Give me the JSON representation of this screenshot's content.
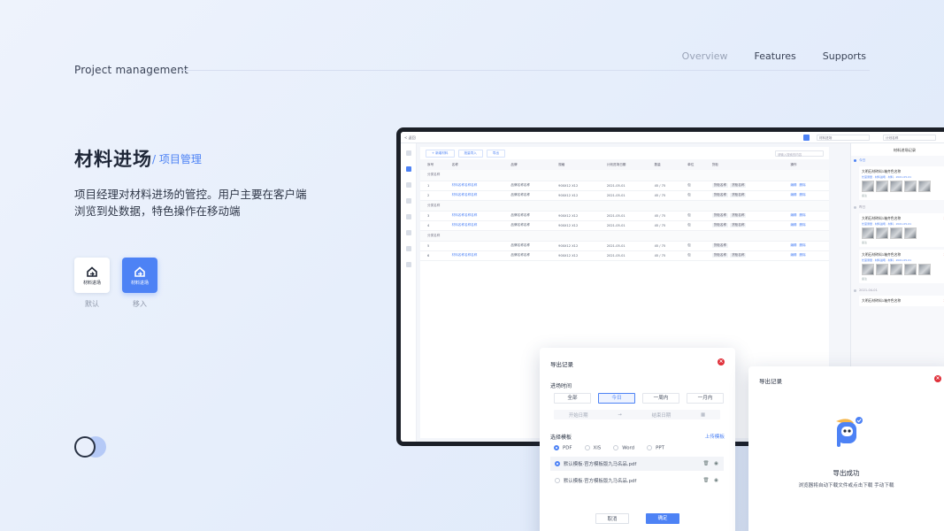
{
  "header": {
    "title": "Project management",
    "nav": [
      {
        "label": "Overview"
      },
      {
        "label": "Features"
      },
      {
        "label": "Supports"
      }
    ]
  },
  "hero": {
    "title": "材料进场",
    "subtitle": "/ 项目管理",
    "description": "项目经理对材料进场的管控。用户主要在客户端浏览到处数据，特色操作在移动端"
  },
  "icon_cards": [
    {
      "inner_label": "材料进场",
      "caption": "默认"
    },
    {
      "inner_label": "材料进场",
      "caption": "移入"
    }
  ],
  "colors": {
    "accent": "#4d82f5",
    "danger": "#e0303a",
    "success": "#3bb36a"
  },
  "app": {
    "back": "< 返回",
    "selects": [
      "材料进场",
      "计划名称"
    ],
    "toolbar": [
      "+ 新增材料",
      "批量导入",
      "导出"
    ],
    "search_placeholder": "请输入搜索的内容",
    "table_headers": [
      "序号",
      "名称",
      "品牌",
      "规格",
      "计划进场日期",
      "数量",
      "单位",
      "货柜",
      "操作"
    ],
    "groups": [
      {
        "name": "分类名称",
        "rows": [
          {
            "no": "1",
            "name": "材料名称名称名称",
            "brand": "品牌名称名称",
            "spec": "900X12 X12",
            "date": "2021-05-01",
            "qty": "45 / 75",
            "unit": "包",
            "tags": [
              "货柜名称",
              "货柜名称"
            ],
            "actions": [
              "编辑",
              "删除"
            ]
          },
          {
            "no": "2",
            "name": "材料名称名称名称",
            "brand": "品牌名称名称",
            "spec": "900X12 X12",
            "date": "2021-05-01",
            "qty": "45 / 75",
            "unit": "包",
            "tags": [
              "货柜名称",
              "货柜名称"
            ],
            "actions": [
              "编辑",
              "删除"
            ]
          }
        ]
      },
      {
        "name": "分类名称",
        "rows": [
          {
            "no": "3",
            "name": "材料名称名称名称",
            "brand": "品牌名称名称",
            "spec": "900X12 X12",
            "date": "2021-05-01",
            "qty": "45 / 75",
            "unit": "包",
            "tags": [
              "货柜名称",
              "货柜名称"
            ],
            "actions": [
              "编辑",
              "删除"
            ]
          },
          {
            "no": "4",
            "name": "材料名称名称名称",
            "brand": "品牌名称名称",
            "spec": "900X12 X12",
            "date": "2021-05-01",
            "qty": "45 / 75",
            "unit": "包",
            "tags": [
              "货柜名称",
              "货柜名称"
            ],
            "actions": [
              "编辑",
              "删除"
            ]
          }
        ]
      },
      {
        "name": "分类名称",
        "rows": [
          {
            "no": "5",
            "name": "",
            "brand": "品牌名称名称",
            "spec": "900X12 X12",
            "date": "2021-05-01",
            "qty": "45 / 75",
            "unit": "包",
            "tags": [
              "货柜名称"
            ],
            "actions": [
              "编辑",
              "删除"
            ]
          },
          {
            "no": "6",
            "name": "材料名称名称名称",
            "brand": "品牌名称名称",
            "spec": "900X12 X12",
            "date": "2021-05-01",
            "qty": "45 / 75",
            "unit": "包",
            "tags": [
              "货柜名称",
              "货柜名称"
            ],
            "actions": [
              "编辑",
              "删除"
            ]
          }
        ]
      }
    ],
    "records_panel": {
      "title": "材料进场记录",
      "days": [
        {
          "label": "今日",
          "cards": [
            {
              "title": "大明石材砖料1箱齐色名称",
              "status": "合格",
              "ok": true,
              "meta": "长度测量 · 材料进场 · 材料 · 2021-05-01",
              "note": "备注",
              "imgs": 5
            }
          ]
        },
        {
          "label": "昨日",
          "cards": [
            {
              "title": "大明石材砖料1箱齐色名称",
              "status": "不合格",
              "ok": false,
              "meta": "长度测量 · 材料进场 · 材料 · 2021-05-01",
              "note": "备注",
              "imgs": 4
            },
            {
              "title": "大明石材砖料1箱齐色名称",
              "status": "不合格",
              "ok": false,
              "meta": "长度测量 · 材料进场 · 材料 · 2021-05-01",
              "note": "备注",
              "imgs": 5
            }
          ]
        },
        {
          "label": "2021-04-01",
          "cards": [
            {
              "title": "大明石材砖料1箱齐色名称",
              "status": "不合格",
              "ok": false,
              "meta": "",
              "note": "",
              "imgs": 0
            }
          ]
        }
      ]
    }
  },
  "export_dialog": {
    "title": "导出记录",
    "time_label": "进场时间",
    "ranges": [
      "全部",
      "今日",
      "一周内",
      "一月内"
    ],
    "selected_range": "今日",
    "start_placeholder": "开始日期",
    "end_placeholder": "结束日期",
    "template_label": "选择模板",
    "upload_label": "上传模板",
    "formats": [
      "PDF",
      "XIS",
      "Word",
      "PPT"
    ],
    "selected_format": "PDF",
    "files": [
      "默认模板·官方模板版九马名品.pdf",
      "默认模板·官方模板版九马名品.pdf"
    ],
    "cancel_label": "取消",
    "ok_label": "确定"
  },
  "success_dialog": {
    "title": "导出记录",
    "message": "导出成功",
    "detail": "浏览器将自动下载文件或点击下载 手动下载"
  }
}
